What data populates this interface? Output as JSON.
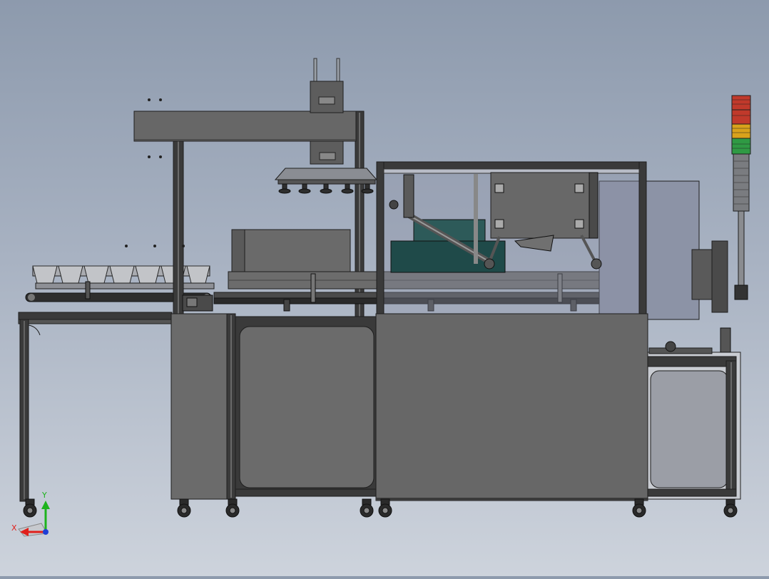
{
  "viewport": {
    "background_top": "#8d9aad",
    "background_bottom": "#cdd3dc"
  },
  "triad": {
    "x_label": "X",
    "y_label": "Y",
    "x_color": "#e0201c",
    "y_color": "#1db31d",
    "z_color": "#1f3fd6"
  },
  "colors": {
    "panel": "#6b6b6b",
    "panel_dark": "#5e5e5e",
    "frame": "#3a3a3a",
    "edge": "#1e1e1e",
    "glass": "#8c93a6",
    "teal": "#1f4a49",
    "light_panel": "#9b9ea6"
  },
  "signal_tower": {
    "segments": [
      "#c0392b",
      "#d9a21b",
      "#2f9a44"
    ]
  }
}
